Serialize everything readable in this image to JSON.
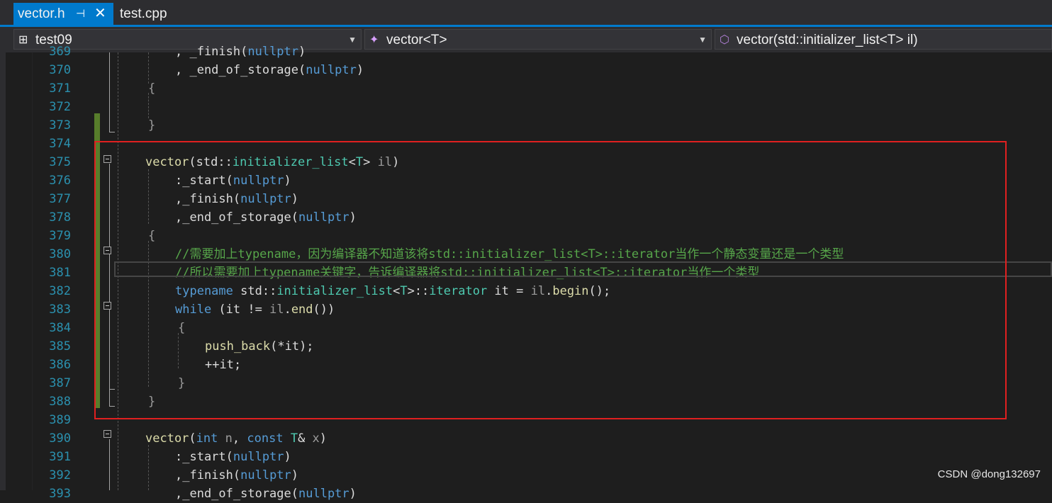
{
  "tabs": [
    {
      "label": "vector.h",
      "active": true,
      "pin_icon": "pin-icon",
      "close_icon": "close-icon"
    },
    {
      "label": "test.cpp",
      "active": false
    }
  ],
  "nav": {
    "project": "test09",
    "scope": "vector<T>",
    "member": "vector(std::initializer_list<T> il)"
  },
  "editor": {
    "lines": [
      {
        "n": "369",
        "tokens": [
          {
            "t": ", _finish(",
            "c": ""
          },
          {
            "t": "nullptr",
            "c": "k"
          },
          {
            "t": ")",
            "c": ""
          }
        ]
      },
      {
        "n": "370",
        "tokens": [
          {
            "t": ", _end_of_storage(",
            "c": ""
          },
          {
            "t": "nullptr",
            "c": "k"
          },
          {
            "t": ")",
            "c": ""
          }
        ]
      },
      {
        "n": "371",
        "tokens": [
          {
            "t": "{",
            "c": "p"
          }
        ]
      },
      {
        "n": "372",
        "tokens": []
      },
      {
        "n": "373",
        "tokens": [
          {
            "t": "}",
            "c": "p"
          }
        ]
      },
      {
        "n": "374",
        "tokens": []
      },
      {
        "n": "375",
        "tokens": [
          {
            "t": "vector",
            "c": "f"
          },
          {
            "t": "(std::",
            "c": ""
          },
          {
            "t": "initializer_list",
            "c": "ty"
          },
          {
            "t": "<",
            "c": ""
          },
          {
            "t": "T",
            "c": "ty"
          },
          {
            "t": "> ",
            "c": ""
          },
          {
            "t": "il",
            "c": "p"
          },
          {
            "t": ")",
            "c": ""
          }
        ]
      },
      {
        "n": "376",
        "tokens": [
          {
            "t": ":_start(",
            "c": ""
          },
          {
            "t": "nullptr",
            "c": "k"
          },
          {
            "t": ")",
            "c": ""
          }
        ]
      },
      {
        "n": "377",
        "tokens": [
          {
            "t": ",_finish(",
            "c": ""
          },
          {
            "t": "nullptr",
            "c": "k"
          },
          {
            "t": ")",
            "c": ""
          }
        ]
      },
      {
        "n": "378",
        "tokens": [
          {
            "t": ",_end_of_storage(",
            "c": ""
          },
          {
            "t": "nullptr",
            "c": "k"
          },
          {
            "t": ")",
            "c": ""
          }
        ]
      },
      {
        "n": "379",
        "tokens": [
          {
            "t": "{",
            "c": "p"
          }
        ]
      },
      {
        "n": "380",
        "tokens": [
          {
            "t": "//需要加上typename，因为编译器不知道该将std::initializer_list<T>::iterator当作一个静态变量还是一个类型",
            "c": "c"
          }
        ]
      },
      {
        "n": "381",
        "tokens": [
          {
            "t": "//所以需要加上typename关键字，告诉编译器将std::initializer_list<T>::iterator当作一个类型",
            "c": "c"
          }
        ]
      },
      {
        "n": "382",
        "tokens": [
          {
            "t": "typename",
            "c": "k"
          },
          {
            "t": " std::",
            "c": ""
          },
          {
            "t": "initializer_list",
            "c": "ty"
          },
          {
            "t": "<",
            "c": ""
          },
          {
            "t": "T",
            "c": "ty"
          },
          {
            "t": ">::",
            "c": ""
          },
          {
            "t": "iterator",
            "c": "ty"
          },
          {
            "t": " it = ",
            "c": ""
          },
          {
            "t": "il",
            "c": "p"
          },
          {
            "t": ".",
            "c": ""
          },
          {
            "t": "begin",
            "c": "f"
          },
          {
            "t": "();",
            "c": ""
          }
        ]
      },
      {
        "n": "383",
        "tokens": [
          {
            "t": "while",
            "c": "k"
          },
          {
            "t": " (it != ",
            "c": ""
          },
          {
            "t": "il",
            "c": "p"
          },
          {
            "t": ".",
            "c": ""
          },
          {
            "t": "end",
            "c": "f"
          },
          {
            "t": "())",
            "c": ""
          }
        ]
      },
      {
        "n": "384",
        "tokens": [
          {
            "t": "{",
            "c": "p"
          }
        ]
      },
      {
        "n": "385",
        "tokens": [
          {
            "t": "push_back",
            "c": "f"
          },
          {
            "t": "(*it);",
            "c": ""
          }
        ]
      },
      {
        "n": "386",
        "tokens": [
          {
            "t": "++it;",
            "c": ""
          }
        ]
      },
      {
        "n": "387",
        "tokens": [
          {
            "t": "}",
            "c": "p"
          }
        ]
      },
      {
        "n": "388",
        "tokens": [
          {
            "t": "}",
            "c": "p"
          }
        ]
      },
      {
        "n": "389",
        "tokens": []
      },
      {
        "n": "390",
        "tokens": [
          {
            "t": "vector",
            "c": "f"
          },
          {
            "t": "(",
            "c": ""
          },
          {
            "t": "int",
            "c": "k"
          },
          {
            "t": " ",
            "c": ""
          },
          {
            "t": "n",
            "c": "p"
          },
          {
            "t": ", ",
            "c": ""
          },
          {
            "t": "const",
            "c": "k"
          },
          {
            "t": " ",
            "c": ""
          },
          {
            "t": "T",
            "c": "ty"
          },
          {
            "t": "& ",
            "c": ""
          },
          {
            "t": "x",
            "c": "p"
          },
          {
            "t": ")",
            "c": ""
          }
        ]
      },
      {
        "n": "391",
        "tokens": [
          {
            "t": ":_start(",
            "c": ""
          },
          {
            "t": "nullptr",
            "c": "k"
          },
          {
            "t": ")",
            "c": ""
          }
        ]
      },
      {
        "n": "392",
        "tokens": [
          {
            "t": ",_finish(",
            "c": ""
          },
          {
            "t": "nullptr",
            "c": "k"
          },
          {
            "t": ")",
            "c": ""
          }
        ]
      },
      {
        "n": "393",
        "tokens": [
          {
            "t": ",_end_of_storage(",
            "c": ""
          },
          {
            "t": "nullptr",
            "c": "k"
          },
          {
            "t": ")",
            "c": ""
          }
        ]
      }
    ]
  },
  "watermark": "CSDN @dong132697",
  "colors": {
    "accent": "#007acc",
    "highlight_box": "#e02020",
    "changed_bar": "#577d2b"
  }
}
